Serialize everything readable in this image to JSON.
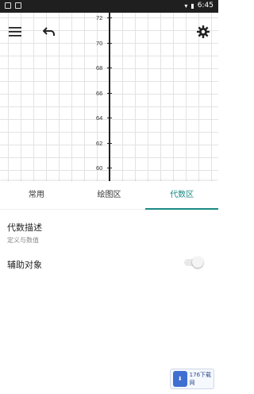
{
  "status_bar": {
    "time": "6:45"
  },
  "graph": {
    "y_ticks": [
      "72",
      "70",
      "68",
      "66",
      "64",
      "62",
      "60"
    ]
  },
  "toolbar": {
    "menu_icon": "hamburger-menu-icon",
    "undo_icon": "undo-icon",
    "settings_icon": "gear-icon"
  },
  "tabs": [
    {
      "label": "常用",
      "active": false
    },
    {
      "label": "绘图区",
      "active": false
    },
    {
      "label": "代数区",
      "active": true
    }
  ],
  "algebra": {
    "desc_title": "代数描述",
    "desc_sub": "定义与数值",
    "aux_label": "辅助对象",
    "aux_toggle_on": false
  },
  "watermark": {
    "text": "176下载网"
  },
  "colors": {
    "accent": "#1c8a84",
    "status_bar": "#1f1f1f"
  }
}
